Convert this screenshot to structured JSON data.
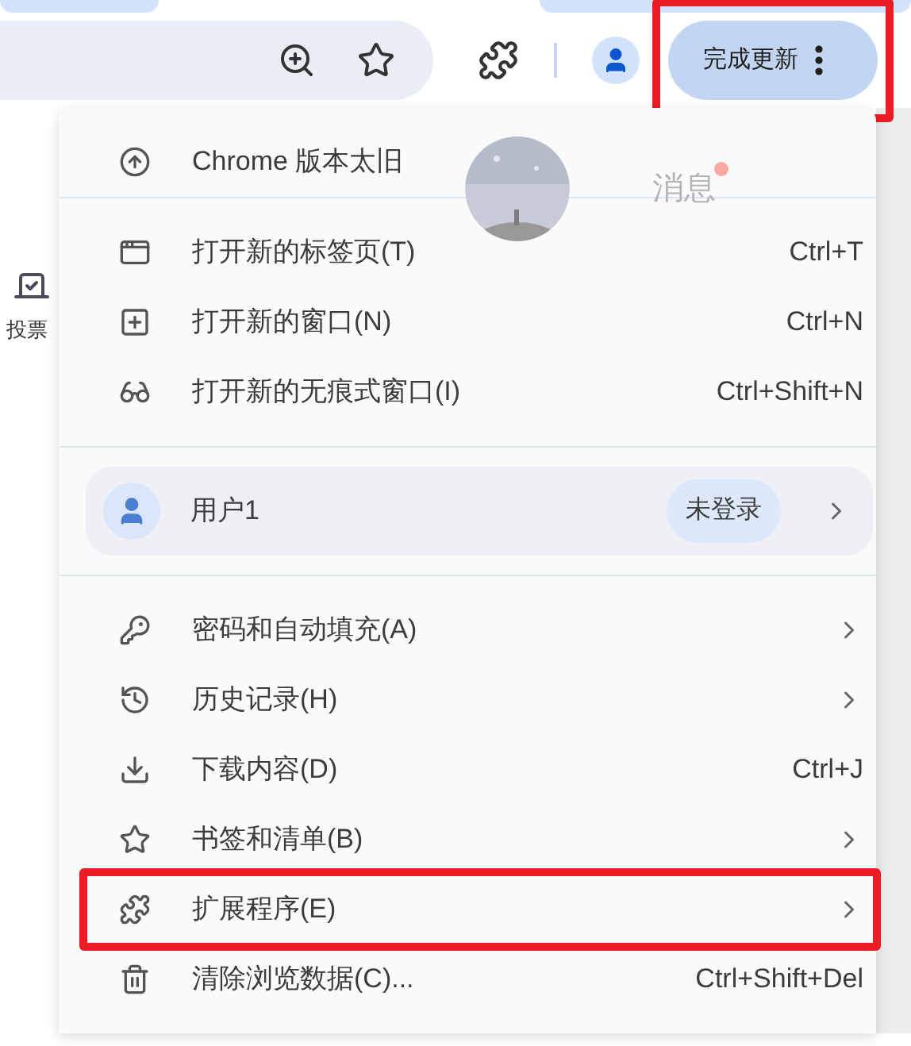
{
  "toolbar": {
    "update_button": {
      "label": "完成更新",
      "highlighted": true
    }
  },
  "background": {
    "messages": "消息",
    "vote": "投票"
  },
  "menu": {
    "notice": "Chrome 版本太旧",
    "groups": [
      {
        "items": [
          {
            "label": "打开新的标签页(T)",
            "shortcut": "Ctrl+T"
          },
          {
            "label": "打开新的窗口(N)",
            "shortcut": "Ctrl+N"
          },
          {
            "label": "打开新的无痕式窗口(I)",
            "shortcut": "Ctrl+Shift+N"
          }
        ]
      },
      {
        "profile": {
          "name": "用户1",
          "status": "未登录"
        }
      },
      {
        "items": [
          {
            "label": "密码和自动填充(A)",
            "submenu": true
          },
          {
            "label": "历史记录(H)",
            "submenu": true
          },
          {
            "label": "下载内容(D)",
            "shortcut": "Ctrl+J"
          },
          {
            "label": "书签和清单(B)",
            "submenu": true
          },
          {
            "label": "扩展程序(E)",
            "submenu": true,
            "highlighted": true
          },
          {
            "label": "清除浏览数据(C)...",
            "shortcut": "Ctrl+Shift+Del"
          }
        ]
      }
    ]
  }
}
